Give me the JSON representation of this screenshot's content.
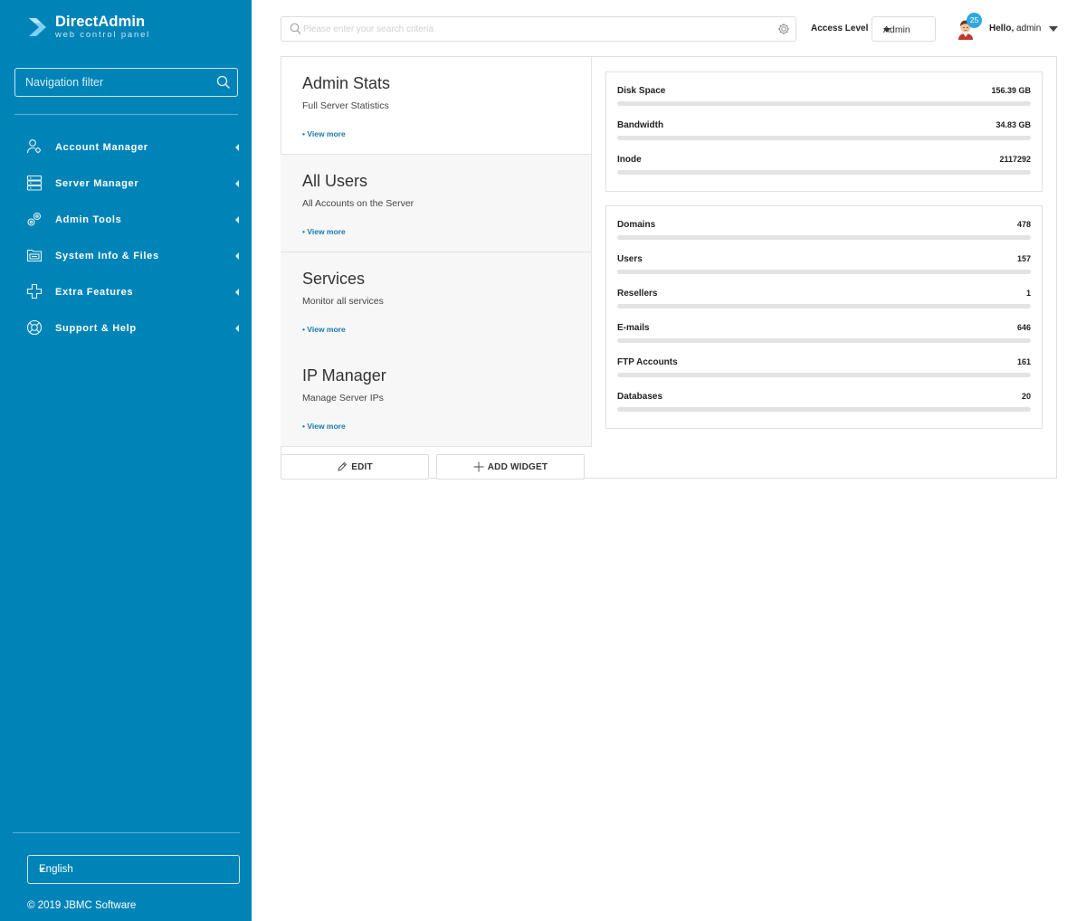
{
  "brand": {
    "title": "DirectAdmin",
    "subtitle": "web control panel"
  },
  "sidebar": {
    "filter_placeholder": "Navigation filter",
    "items": [
      {
        "label": "Account Manager",
        "icon": "account-manager-icon"
      },
      {
        "label": "Server Manager",
        "icon": "server-manager-icon"
      },
      {
        "label": "Admin Tools",
        "icon": "admin-tools-icon"
      },
      {
        "label": "System Info & Files",
        "icon": "system-info-icon"
      },
      {
        "label": "Extra Features",
        "icon": "extra-features-icon"
      },
      {
        "label": "Support & Help",
        "icon": "support-help-icon"
      }
    ],
    "language": "English",
    "copyright": "© 2019 JBMC Software"
  },
  "header": {
    "search_placeholder": "Please enter your search criteria",
    "access_level_label": "Access Level",
    "access_level_value": "Admin",
    "notification_count": "25",
    "greeting": "Hello,",
    "username": "admin"
  },
  "widgets": [
    {
      "title": "Admin Stats",
      "description": "Full Server Statistics",
      "link": "• View more"
    },
    {
      "title": "All Users",
      "description": "All Accounts on the Server",
      "link": "• View more"
    },
    {
      "title": "Services",
      "description": "Monitor all services",
      "link": "• View more"
    },
    {
      "title": "IP Manager",
      "description": "Manage Server IPs",
      "link": "• View more"
    }
  ],
  "actions": {
    "edit": "EDIT",
    "add_widget": "ADD WIDGET"
  },
  "usage_stats": [
    {
      "name": "Disk Space",
      "value": "156.39 GB"
    },
    {
      "name": "Bandwidth",
      "value": "34.83 GB"
    },
    {
      "name": "Inode",
      "value": "2117292"
    }
  ],
  "count_stats": [
    {
      "name": "Domains",
      "value": "478"
    },
    {
      "name": "Users",
      "value": "157"
    },
    {
      "name": "Resellers",
      "value": "1"
    },
    {
      "name": "E-mails",
      "value": "646"
    },
    {
      "name": "FTP Accounts",
      "value": "161"
    },
    {
      "name": "Databases",
      "value": "20"
    }
  ],
  "colors": {
    "sidebar": "#0084b8",
    "link": "#1779b0",
    "badge": "#2fa8e0"
  }
}
